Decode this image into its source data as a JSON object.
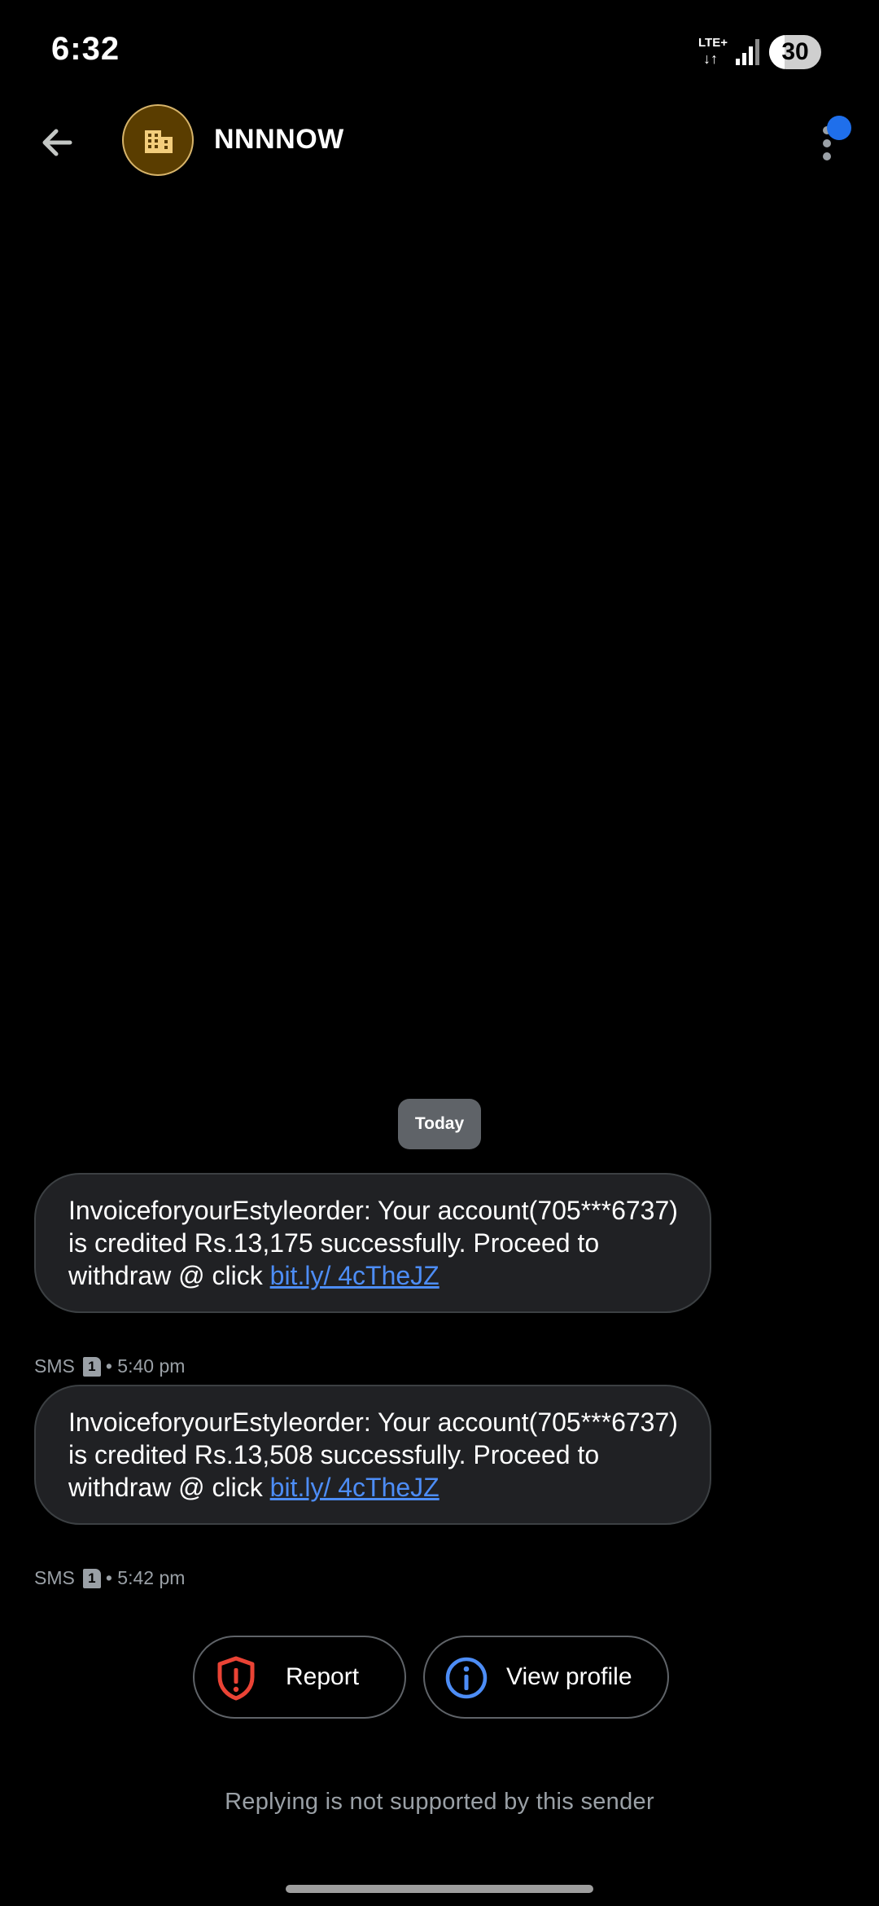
{
  "status_bar": {
    "time": "6:32",
    "network": "LTE+",
    "network_arrows": "↓↑",
    "battery_level": "30",
    "battery_fraction": 0.3
  },
  "header": {
    "contact_name": "NNNNOW",
    "avatar_icon": "building-icon",
    "avatar_color": "#5a3d00",
    "notification_dot_color": "#1f6feb"
  },
  "conversation": {
    "date_label": "Today",
    "messages": [
      {
        "text": "InvoiceforyourEstyleorder: Your account(705***6737) is credited Rs.13,175 successfully. Proceed to withdraw @ click ",
        "link": "bit.ly/ 4cTheJZ",
        "channel": "SMS",
        "sim": "1",
        "time": "• 5:40 pm"
      },
      {
        "text": "InvoiceforyourEstyleorder: Your account(705***6737) is credited Rs.13,508 successfully. Proceed to withdraw @ click ",
        "link": "bit.ly/ 4cTheJZ",
        "channel": "SMS",
        "sim": "1",
        "time": "• 5:42 pm"
      }
    ]
  },
  "actions": {
    "report_label": "Report",
    "report_icon": "shield-alert-icon",
    "report_color": "#ea4335",
    "profile_label": "View profile",
    "profile_icon": "info-icon",
    "profile_color": "#4d8df6"
  },
  "footer": {
    "reply_note": "Replying is not supported by this sender"
  }
}
